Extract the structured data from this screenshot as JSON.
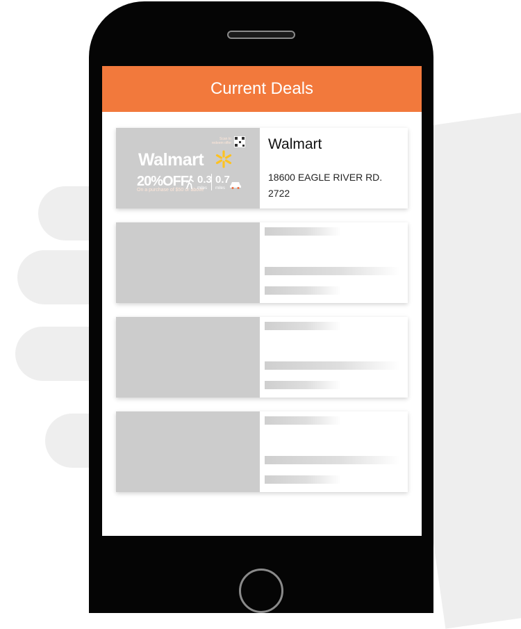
{
  "header": {
    "title": "Current Deals"
  },
  "deals": [
    {
      "name": "Walmart",
      "address_line1": "18600 EAGLE RIVER RD.",
      "address_line2": "2722",
      "ad": {
        "brand": "Walmart",
        "discount": "20%OFF",
        "fine_print": "On a purchase of $50 or above",
        "walk_distance": "0.3",
        "walk_unit": "miles",
        "drive_distance": "0.7",
        "drive_unit": "miles",
        "qr_caption": "Scan to redeem offer",
        "brand_color": "#ef6a3b",
        "spark_color": "#ffc220"
      }
    }
  ],
  "colors": {
    "header": "#f2793c",
    "placeholder": "#cccccc"
  }
}
